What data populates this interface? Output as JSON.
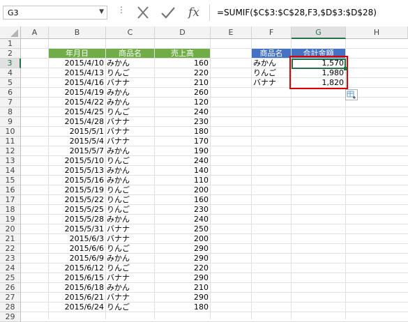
{
  "name_box": "G3",
  "formula": "=SUMIF($C$3:$C$28,F3,$D$3:$D$28)",
  "columns": [
    "A",
    "B",
    "C",
    "D",
    "E",
    "F",
    "G",
    "H"
  ],
  "selected_column": "G",
  "selected_row": "3",
  "rows": [
    "1",
    "2",
    "3",
    "4",
    "5",
    "6",
    "7",
    "8",
    "9",
    "10",
    "11",
    "12",
    "13",
    "14",
    "15",
    "16",
    "17",
    "18",
    "19",
    "20",
    "21",
    "22",
    "23",
    "24",
    "25",
    "26",
    "27",
    "28",
    "29"
  ],
  "table": {
    "headers": [
      "年月日",
      "商品名",
      "売上高"
    ],
    "records": [
      [
        "2015/4/10",
        "みかん",
        "160"
      ],
      [
        "2015/4/13",
        "りんご",
        "220"
      ],
      [
        "2015/4/16",
        "バナナ",
        "210"
      ],
      [
        "2015/4/19",
        "みかん",
        "260"
      ],
      [
        "2015/4/22",
        "みかん",
        "120"
      ],
      [
        "2015/4/25",
        "りんご",
        "240"
      ],
      [
        "2015/4/28",
        "バナナ",
        "230"
      ],
      [
        "2015/5/1",
        "バナナ",
        "180"
      ],
      [
        "2015/5/4",
        "バナナ",
        "170"
      ],
      [
        "2015/5/7",
        "みかん",
        "190"
      ],
      [
        "2015/5/10",
        "りんご",
        "240"
      ],
      [
        "2015/5/13",
        "みかん",
        "140"
      ],
      [
        "2015/5/16",
        "みかん",
        "110"
      ],
      [
        "2015/5/19",
        "りんご",
        "200"
      ],
      [
        "2015/5/22",
        "りんご",
        "160"
      ],
      [
        "2015/5/25",
        "りんご",
        "230"
      ],
      [
        "2015/5/28",
        "みかん",
        "240"
      ],
      [
        "2015/5/31",
        "バナナ",
        "250"
      ],
      [
        "2015/6/3",
        "バナナ",
        "200"
      ],
      [
        "2015/6/6",
        "りんご",
        "290"
      ],
      [
        "2015/6/9",
        "みかん",
        "290"
      ],
      [
        "2015/6/12",
        "りんご",
        "220"
      ],
      [
        "2015/6/15",
        "バナナ",
        "290"
      ],
      [
        "2015/6/18",
        "みかん",
        "210"
      ],
      [
        "2015/6/21",
        "バナナ",
        "290"
      ],
      [
        "2015/6/24",
        "りんご",
        "180"
      ]
    ]
  },
  "summary": {
    "headers": [
      "商品名",
      "合計金額"
    ],
    "records": [
      [
        "みかん",
        "1,570"
      ],
      [
        "りんご",
        "1,980"
      ],
      [
        "バナナ",
        "1,820"
      ]
    ]
  },
  "colors": {
    "table_header": "#70ad47",
    "summary_header": "#4472c4",
    "selection": "#217346",
    "highlight": "#e00000"
  }
}
